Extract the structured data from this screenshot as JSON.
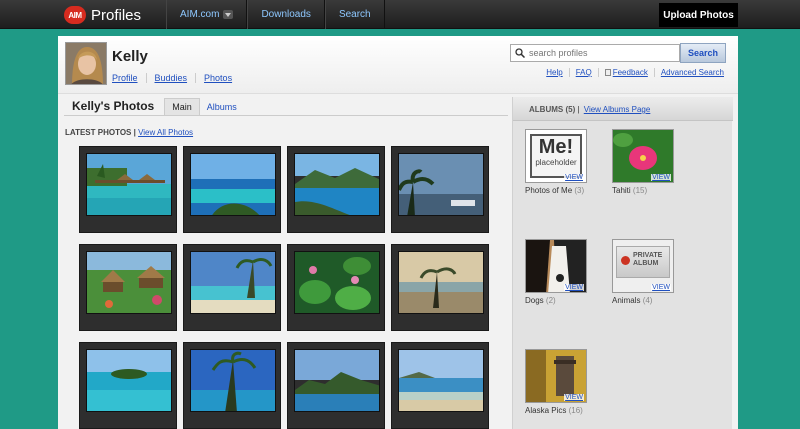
{
  "topbar": {
    "logo_text": "AIM",
    "brand": "Profiles",
    "nav": [
      "AIM.com",
      "Downloads",
      "Search"
    ],
    "upload": "Upload Photos"
  },
  "profile": {
    "name": "Kelly",
    "links": [
      "Profile",
      "Buddies",
      "Photos"
    ]
  },
  "search": {
    "placeholder": "search profiles",
    "button": "Search",
    "links": [
      "Help",
      "FAQ",
      "Feedback",
      "Advanced Search"
    ]
  },
  "tabs": {
    "title": "Kelly's Photos",
    "items": [
      "Main",
      "Albums"
    ]
  },
  "latest": {
    "label": "LATEST PHOTOS",
    "link": "View All Photos"
  },
  "photos": [
    "overwater bungalows",
    "turquoise lagoon",
    "bay with boats",
    "palm beach sunset",
    "thatched huts",
    "beach with pier",
    "water lilies",
    "palm tree beach",
    "small island",
    "palm over lagoon",
    "mountain island",
    "beach shoreline"
  ],
  "albums": {
    "title": "ALBUMS",
    "count": "(5)",
    "link": "View Albums Page",
    "view_label": "VIEW",
    "me_big": "Me!",
    "me_small": "placeholder",
    "private_line1": "PRIVATE",
    "private_line2": "ALBUM",
    "items": [
      {
        "name": "Photos of Me",
        "count": "(3)"
      },
      {
        "name": "Tahiti",
        "count": "(15)"
      },
      {
        "name": "Dogs",
        "count": "(2)"
      },
      {
        "name": "Animals",
        "count": "(4)"
      },
      {
        "name": "Alaska Pics",
        "count": "(16)"
      }
    ]
  },
  "colors": {
    "background": "#1f9a86",
    "link": "#1f4fbf",
    "topbar": "#2a2a2a"
  }
}
